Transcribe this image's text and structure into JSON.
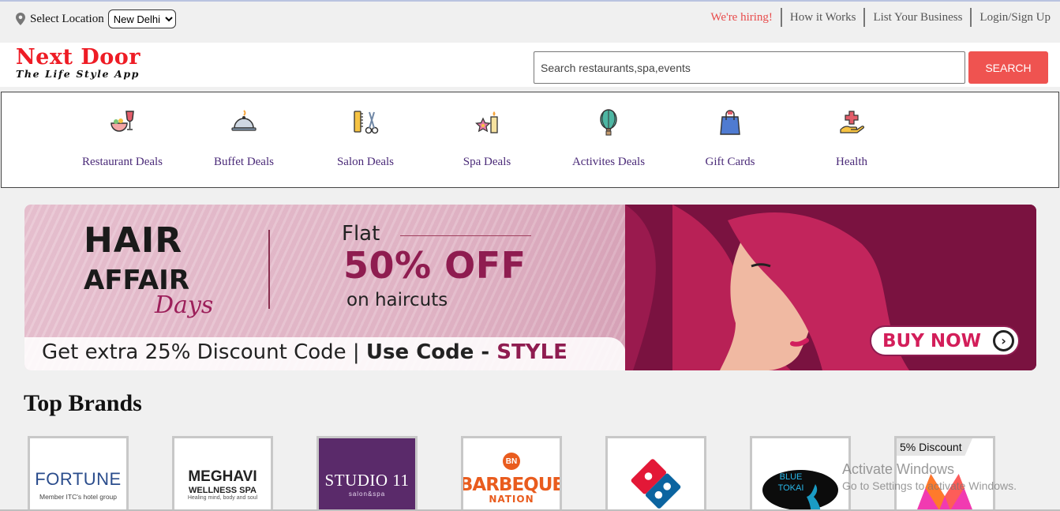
{
  "topbar": {
    "location_label": "Select Location",
    "location_value": "New Delhi",
    "links": {
      "hiring": "We're hiring!",
      "how": "How it Works",
      "list": "List Your Business",
      "login": "Login/Sign Up"
    }
  },
  "header": {
    "logo_line1": "Next Door",
    "logo_line2": "The Life Style App",
    "search_placeholder": "Search restaurants,spa,events",
    "search_button": "SEARCH"
  },
  "categories": [
    {
      "label": "Restaurant Deals",
      "icon": "restaurant-icon"
    },
    {
      "label": "Buffet Deals",
      "icon": "buffet-icon"
    },
    {
      "label": "Salon Deals",
      "icon": "salon-icon"
    },
    {
      "label": "Spa Deals",
      "icon": "spa-icon"
    },
    {
      "label": "Activites Deals",
      "icon": "balloon-icon"
    },
    {
      "label": "Gift Cards",
      "icon": "gift-bag-icon"
    },
    {
      "label": "Health",
      "icon": "health-icon"
    }
  ],
  "banner": {
    "hair": "HAIR",
    "affair": "AFFAIR",
    "days": "Days",
    "flat": "Flat",
    "off": "50% OFF",
    "on": "on haircuts",
    "code_pre": "Get extra 25% Discount Code | ",
    "code_mid": "Use Code - ",
    "code_val": "STYLE",
    "buy": "BUY NOW"
  },
  "brands_title": "Top Brands",
  "brands": [
    {
      "name": "FORTUNE",
      "sub": "Member ITC's hotel group"
    },
    {
      "name": "MEGHAVI",
      "sub": "WELLNESS SPA",
      "tag": "Healing mind, body and soul"
    },
    {
      "name": "STUDIO 11",
      "sub": "salon&spa"
    },
    {
      "name": "BARBEQUE",
      "sub": "NATION",
      "badge": "BN"
    },
    {
      "name": "Domino's",
      "sub": ""
    },
    {
      "name": "BLUE TOKAI",
      "sub": ""
    },
    {
      "name": "Myntra",
      "discount": "5% Discount"
    }
  ],
  "watermark": {
    "line1": "Activate Windows",
    "line2": "Go to Settings to activate Windows."
  },
  "colors": {
    "accent": "#ef5350",
    "brand_red": "#ee1c25",
    "category_text": "#4a2a78",
    "banner_magenta": "#8f1c50"
  }
}
